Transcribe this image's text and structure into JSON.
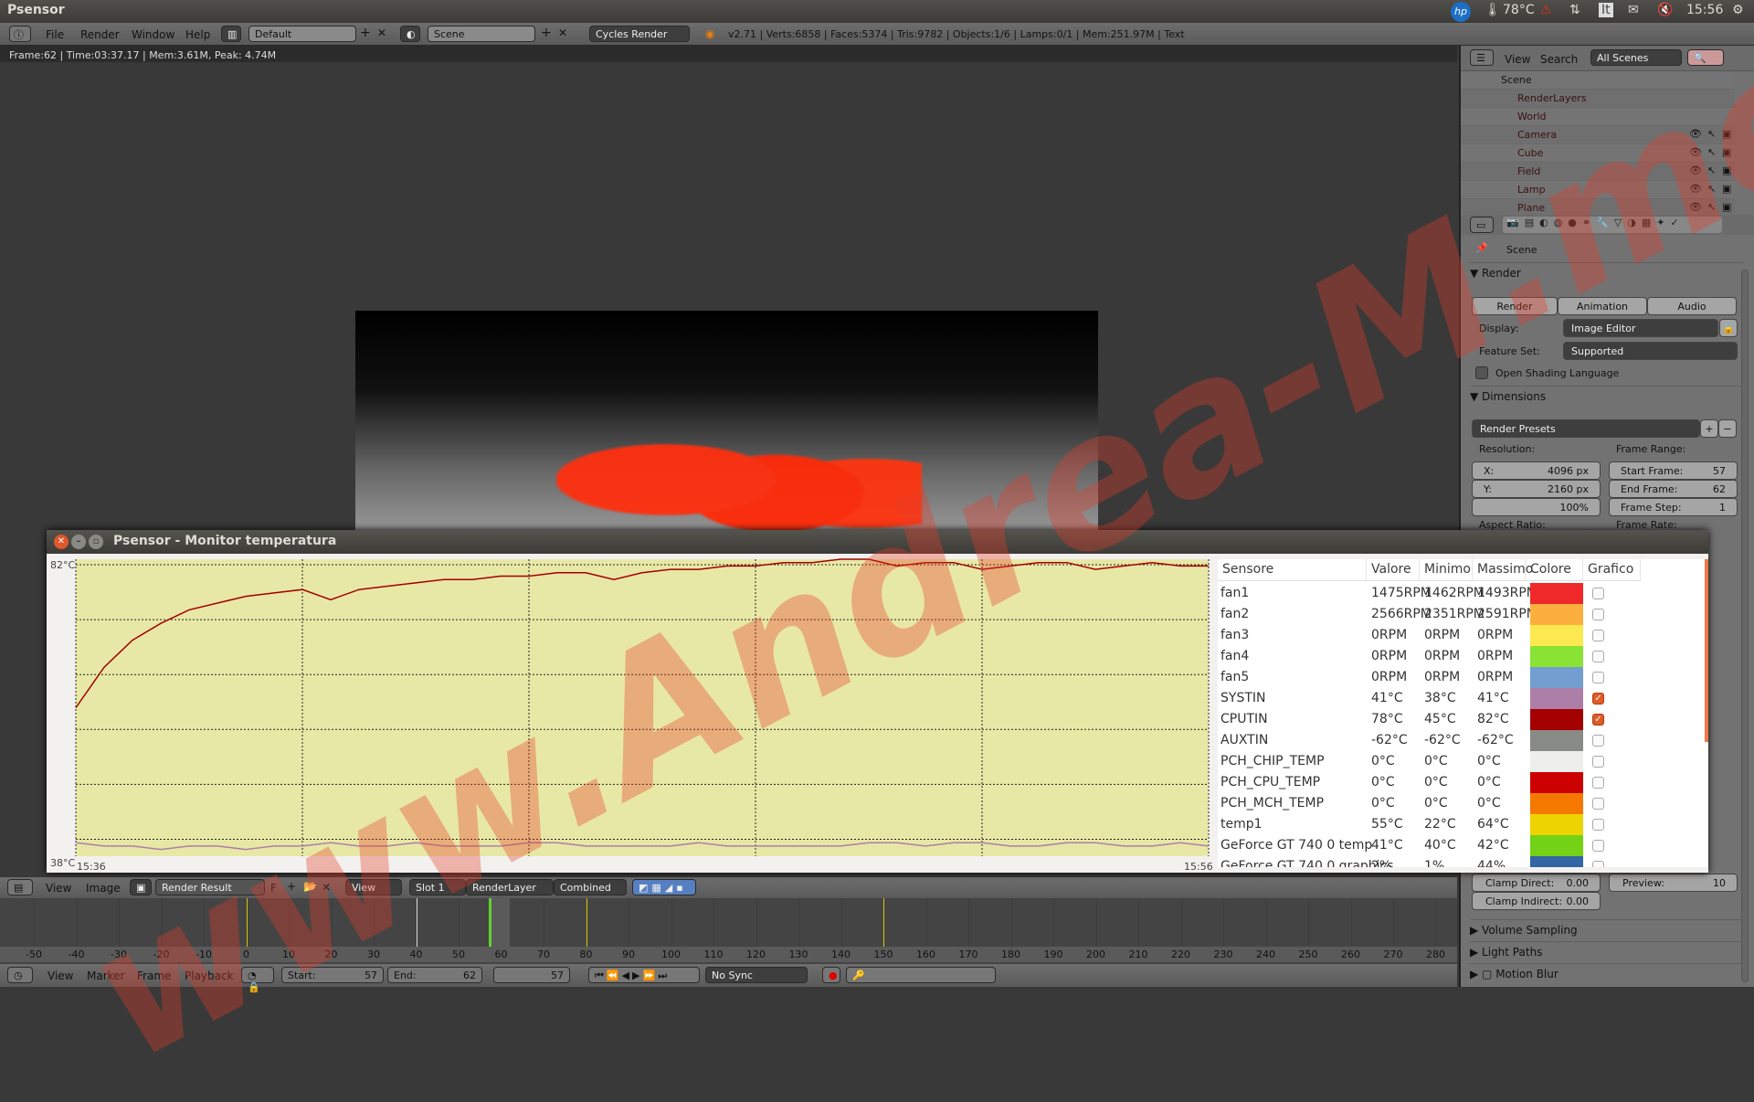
{
  "topbar": {
    "title": "Psensor",
    "temp": "78°C",
    "clock": "15:56",
    "keyboard": "It",
    "icons": [
      "hp-logo-icon",
      "thermometer-icon",
      "warning-icon",
      "network-arrows-icon",
      "keyboard-icon",
      "mail-icon",
      "volume-muted-icon",
      "power-gear-icon"
    ]
  },
  "blender_header": {
    "menus": [
      "File",
      "Render",
      "Window",
      "Help"
    ],
    "layout": "Default",
    "scene": "Scene",
    "engine": "Cycles Render",
    "stats": "v2.71 | Verts:6858 | Faces:5374 | Tris:9782 | Objects:1/6 | Lamps:0/1 | Mem:251.97M | Text"
  },
  "viewport": {
    "frame_info": "Frame:62 | Time:03:37.17 | Mem:3.61M, Peak: 4.74M"
  },
  "outliner": {
    "view": "View",
    "search": "Search",
    "filter": "All Scenes",
    "items": [
      {
        "label": "Scene",
        "indent": 0,
        "color": "#111"
      },
      {
        "label": "RenderLayers",
        "indent": 1,
        "color": "#3a1010"
      },
      {
        "label": "World",
        "indent": 1,
        "color": "#3a1010"
      },
      {
        "label": "Camera",
        "indent": 1,
        "color": "#3a1010"
      },
      {
        "label": "Cube",
        "indent": 1,
        "color": "#3a1010"
      },
      {
        "label": "Field",
        "indent": 1,
        "color": "#3a1010"
      },
      {
        "label": "Lamp",
        "indent": 1,
        "color": "#3a1010"
      },
      {
        "label": "Plane",
        "indent": 1,
        "color": "#3a1010"
      }
    ]
  },
  "properties": {
    "context": "Scene",
    "render_section": "Render",
    "buttons": [
      "Render",
      "Animation",
      "Audio"
    ],
    "display_label": "Display:",
    "display_value": "Image Editor",
    "feature_label": "Feature Set:",
    "feature_value": "Supported",
    "osl": "Open Shading Language",
    "dimensions_section": "Dimensions",
    "presets": "Render Presets",
    "resolution_label": "Resolution:",
    "res_x": "X:",
    "res_x_val": "4096 px",
    "res_y": "Y:",
    "res_y_val": "2160 px",
    "res_pct": "100%",
    "frame_range_label": "Frame Range:",
    "start_label": "Start Frame:",
    "start_val": "57",
    "end_label": "End Frame:",
    "end_val": "62",
    "step_label": "Frame Step:",
    "step_val": "1",
    "aspect_label": "Aspect Ratio:",
    "framerate_label": "Frame Rate:",
    "clamp_direct": "Clamp Direct:",
    "clamp_direct_val": "0.00",
    "clamp_indirect": "Clamp Indirect:",
    "clamp_indirect_val": "0.00",
    "preview": "Preview:",
    "preview_val": "10",
    "sections": [
      "Volume Sampling",
      "Light Paths",
      "Motion Blur"
    ]
  },
  "psensor": {
    "title": "Psensor - Monitor temperatura",
    "columns": [
      "Sensore",
      "Valore",
      "Minimo",
      "Massimo",
      "Colore",
      "Grafico"
    ],
    "rows": [
      {
        "name": "fan1",
        "value": "1475RPM",
        "min": "1462RPM",
        "max": "1493RPM",
        "color": "#ef2929",
        "graph": false
      },
      {
        "name": "fan2",
        "value": "2566RPM",
        "min": "2351RPM",
        "max": "2591RPM",
        "color": "#fcaf3e",
        "graph": false
      },
      {
        "name": "fan3",
        "value": "0RPM",
        "min": "0RPM",
        "max": "0RPM",
        "color": "#fce94f",
        "graph": false
      },
      {
        "name": "fan4",
        "value": "0RPM",
        "min": "0RPM",
        "max": "0RPM",
        "color": "#8ae234",
        "graph": false
      },
      {
        "name": "fan5",
        "value": "0RPM",
        "min": "0RPM",
        "max": "0RPM",
        "color": "#729fcf",
        "graph": false
      },
      {
        "name": "SYSTIN",
        "value": "41°C",
        "min": "38°C",
        "max": "41°C",
        "color": "#ad7fa8",
        "graph": true
      },
      {
        "name": "CPUTIN",
        "value": "78°C",
        "min": "45°C",
        "max": "82°C",
        "color": "#a40000",
        "graph": true
      },
      {
        "name": "AUXTIN",
        "value": "-62°C",
        "min": "-62°C",
        "max": "-62°C",
        "color": "#888a85",
        "graph": false
      },
      {
        "name": "PCH_CHIP_TEMP",
        "value": "0°C",
        "min": "0°C",
        "max": "0°C",
        "color": "#eeeeec",
        "graph": false
      },
      {
        "name": "PCH_CPU_TEMP",
        "value": "0°C",
        "min": "0°C",
        "max": "0°C",
        "color": "#cc0000",
        "graph": false
      },
      {
        "name": "PCH_MCH_TEMP",
        "value": "0°C",
        "min": "0°C",
        "max": "0°C",
        "color": "#f57900",
        "graph": false
      },
      {
        "name": "temp1",
        "value": "55°C",
        "min": "22°C",
        "max": "64°C",
        "color": "#edd400",
        "graph": false
      },
      {
        "name": "GeForce GT 740 0 temp",
        "value": "41°C",
        "min": "40°C",
        "max": "42°C",
        "color": "#73d216",
        "graph": false
      },
      {
        "name": "GeForce GT 740 0 graphics",
        "value": "2%",
        "min": "1%",
        "max": "44%",
        "color": "#3465a4",
        "graph": false
      }
    ]
  },
  "chart_data": {
    "type": "line",
    "ylim": [
      38,
      82
    ],
    "ytick_labels": [
      "82°C",
      "38°C"
    ],
    "x_labels": [
      "15:36",
      "15:56"
    ],
    "grid": true,
    "background": "#e8e8a6",
    "series": [
      {
        "name": "CPUTIN",
        "color": "#a40000",
        "values": [
          60,
          66,
          70,
          72.5,
          74.5,
          75.5,
          76.5,
          77,
          77.5,
          76,
          77.5,
          78,
          78.5,
          79,
          79,
          79.5,
          79.5,
          80,
          80,
          79,
          80,
          80.5,
          80.5,
          81,
          81,
          81.5,
          81.5,
          82,
          82,
          81,
          81.5,
          81.5,
          80.5,
          81,
          81.5,
          81.5,
          80.5,
          81,
          81.5,
          81,
          81
        ]
      },
      {
        "name": "SYSTIN",
        "color": "#ad7fa8",
        "values": [
          40,
          39.5,
          39.5,
          39,
          39.5,
          39.5,
          39,
          39.5,
          39.5,
          40,
          39.5,
          39.5,
          40,
          39.5,
          39.5,
          39.5,
          40,
          40,
          39.5,
          39.5,
          39.5,
          39.5,
          40,
          39.5,
          39.5,
          39.5,
          39.5,
          39.5,
          40,
          40,
          39.5,
          40,
          40,
          39.5,
          39.5,
          40,
          40,
          39.5,
          39.5,
          40,
          39.5
        ]
      }
    ]
  },
  "image_editor_header": {
    "menus": [
      "View",
      "Image"
    ],
    "image": "Render Result",
    "fake_user": "F",
    "view": "View",
    "slot": "Slot 1",
    "layer": "RenderLayer",
    "pass": "Combined"
  },
  "timeline": {
    "ticks": [
      -50,
      -40,
      -30,
      -20,
      -10,
      0,
      10,
      20,
      30,
      40,
      50,
      60,
      70,
      80,
      90,
      100,
      110,
      120,
      130,
      140,
      150,
      160,
      170,
      180,
      190,
      200,
      210,
      220,
      230,
      240,
      250,
      260,
      270,
      280
    ],
    "current_frame": 57,
    "keyframes": [
      0,
      40,
      80,
      150
    ]
  },
  "timeline_header": {
    "menus": [
      "View",
      "Marker",
      "Frame",
      "Playback"
    ],
    "start_label": "Start:",
    "start": "57",
    "end_label": "End:",
    "end": "62",
    "current": "57",
    "sync": "No Sync"
  },
  "watermark": "www.Andrea-M.me"
}
